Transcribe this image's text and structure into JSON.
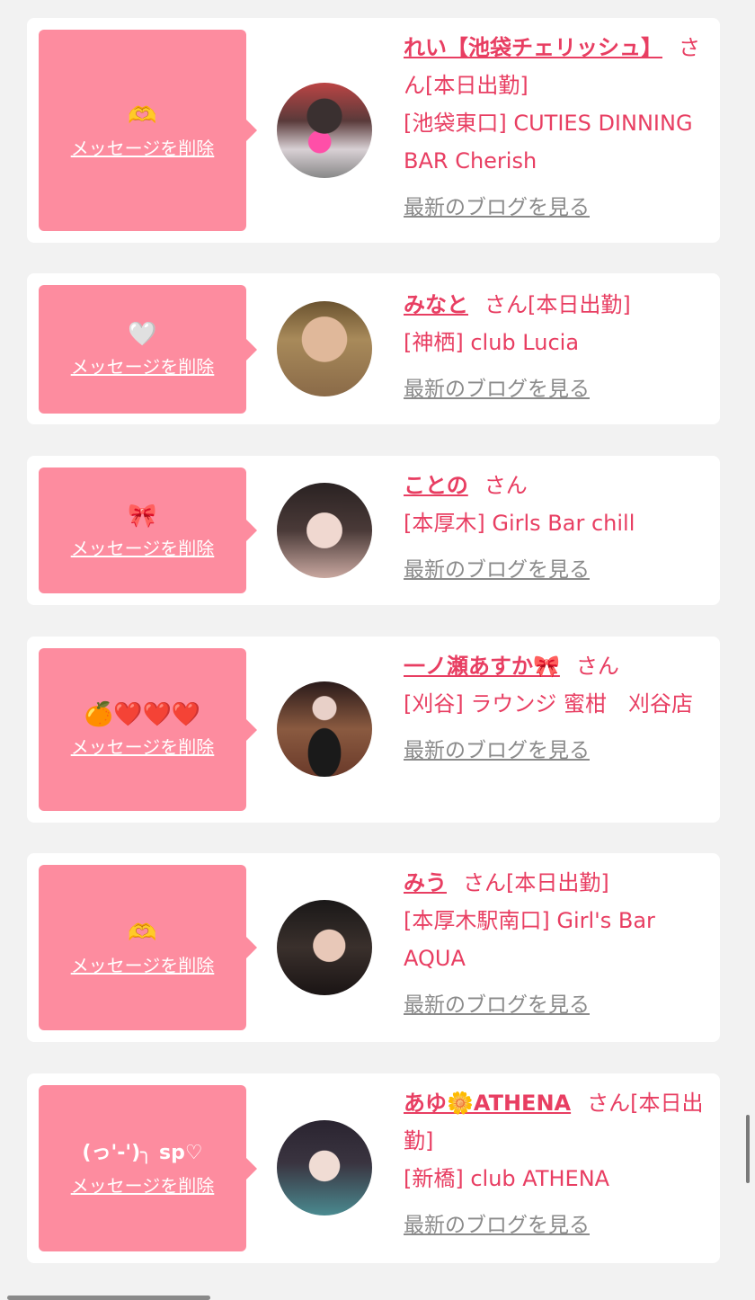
{
  "delete_label": "メッセージを削除",
  "san_label": "さん",
  "blog_label": "最新のブログを見る",
  "accent_color": "#e83e62",
  "bubble_color": "#fd8c9f",
  "entries": [
    {
      "emoji": "🫶",
      "name": "れい【池袋チェリッシュ】",
      "status": "[本日出勤]",
      "shop": "[池袋東口] CUTIES DINNING BAR Cherish",
      "avatar": "avatar-photo"
    },
    {
      "emoji": "🤍",
      "name": "みなと",
      "status": "[本日出勤]",
      "shop": "[神栖] club Lucia",
      "avatar": "avatar-photo"
    },
    {
      "emoji": "🎀",
      "name": "ことの",
      "status": "",
      "shop": "[本厚木] Girls Bar chill",
      "avatar": "avatar-photo"
    },
    {
      "emoji": "🍊❤️❤️❤️",
      "name": "一ノ瀬あすか🎀",
      "status": "",
      "shop": "[刈谷] ラウンジ 蜜柑　刈谷店",
      "avatar": "avatar-photo"
    },
    {
      "emoji": "🫶",
      "name": "みう",
      "status": "[本日出勤]",
      "shop": "[本厚木駅南口] Girl's Bar AQUA",
      "avatar": "avatar-photo"
    },
    {
      "emoji": "(っ'-')╮ sp♡",
      "name": "あゆ🌼ATHENA",
      "status": "[本日出勤]",
      "shop": "[新橋] club ATHENA",
      "avatar": "avatar-photo"
    }
  ]
}
